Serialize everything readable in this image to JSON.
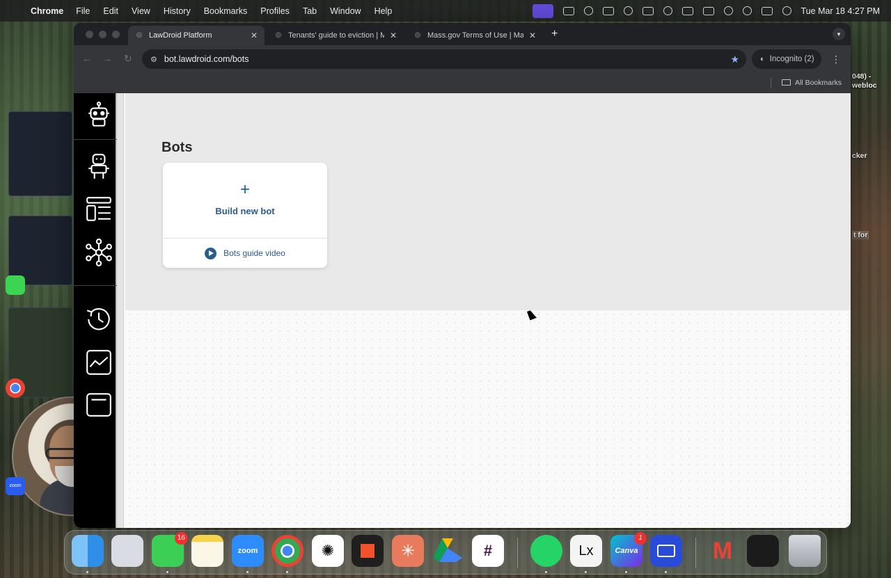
{
  "menubar": {
    "app_name": "Chrome",
    "items": [
      "File",
      "Edit",
      "View",
      "History",
      "Bookmarks",
      "Profiles",
      "Tab",
      "Window",
      "Help"
    ],
    "clock": "Tue Mar 18  4:27 PM"
  },
  "browser": {
    "tabs": [
      {
        "label": "LawDroid Platform",
        "active": true
      },
      {
        "label": "Tenants' guide to eviction | M",
        "active": false
      },
      {
        "label": "Mass.gov Terms of Use | Mas",
        "active": false
      }
    ],
    "url": "bot.lawdroid.com/bots",
    "incognito_label": "Incognito (2)",
    "all_bookmarks_label": "All Bookmarks"
  },
  "page": {
    "title": "Bots",
    "card": {
      "build_icon": "+",
      "build_label": "Build new bot",
      "guide_label": "Bots guide video"
    }
  },
  "sidebar": {
    "items": [
      {
        "name": "logo-robot-icon"
      },
      {
        "name": "bots-icon"
      },
      {
        "name": "templates-icon"
      },
      {
        "name": "network-icon"
      },
      {
        "name": "history-icon"
      },
      {
        "name": "analytics-icon"
      }
    ]
  },
  "desktop": {
    "right_edge_texts": [
      "048) -",
      "webloc",
      "cker",
      "t for"
    ]
  },
  "dock": {
    "messages_badge": "16",
    "canva_badge": "1",
    "apps": [
      "Finder",
      "Launchpad",
      "Messages",
      "Notes",
      "Zoom",
      "Chrome",
      "ChatGPT",
      "Scrivener",
      "Claude",
      "Google Drive",
      "Slack",
      "WhatsApp",
      "Lx",
      "Canva",
      "Printer",
      "Gmail",
      "Chrome Document",
      "Trash"
    ],
    "zoom_label": "zoom",
    "lx_label": "Lx",
    "canva_label": "Canva"
  },
  "webcam": {
    "label": "zoom"
  }
}
